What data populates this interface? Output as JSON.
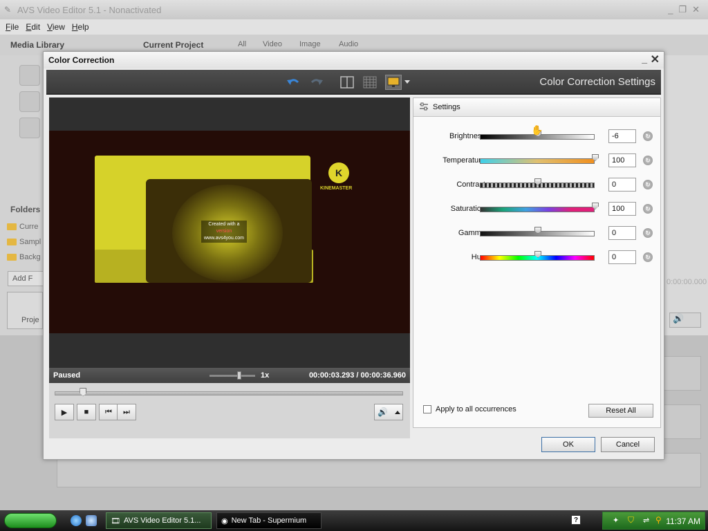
{
  "app": {
    "title": "AVS Video Editor 5.1 - Nonactivated",
    "menu": [
      "File",
      "Edit",
      "View",
      "Help"
    ],
    "media_library_label": "Media Library",
    "current_project_label": "Current Project",
    "filter_tabs": [
      "All",
      "Video",
      "Image",
      "Audio"
    ],
    "folders_label": "Folders",
    "folder_items": [
      "Curre",
      "Sampl",
      "Backg"
    ],
    "add_button_label": "Add F",
    "project_button_label": "Proje",
    "right_time": "0:00:00.000"
  },
  "dialog": {
    "title": "Color Correction",
    "heading": "Color Correction Settings",
    "settings_header": "Settings",
    "status": "Paused",
    "speed": "1x",
    "time": "00:00:03.293 / 00:00:36.960",
    "seek_position": 0.08,
    "speed_position": 0.65,
    "preview_overlay": {
      "brand": "KINEMASTER",
      "logo_letter": "K",
      "line1": "Created with a",
      "line2": "version",
      "line3": "www.avs4you.com"
    },
    "settings": [
      {
        "label": "Brightness:",
        "value": "-6",
        "position": 0.5,
        "track": "linear-gradient(90deg,#000,#fff)"
      },
      {
        "label": "Temperature:",
        "value": "100",
        "position": 1.0,
        "track": "linear-gradient(90deg,#3fd0ea,#e0c070,#f09020)"
      },
      {
        "label": "Contrast:",
        "value": "0",
        "position": 0.5,
        "track": "repeating-linear-gradient(90deg,#222 0 3px,#bbb 3px 6px)"
      },
      {
        "label": "Saturation:",
        "value": "100",
        "position": 1.0,
        "track": "linear-gradient(90deg,#333,#1aa37a,#3fa0e0,#7a3fe0,#e0207a,#e0207a)"
      },
      {
        "label": "Gamma:",
        "value": "0",
        "position": 0.5,
        "track": "linear-gradient(90deg,#111,#fff)"
      },
      {
        "label": "Hue:",
        "value": "0",
        "position": 0.5,
        "track": "linear-gradient(90deg,#ff0000,#ffff00,#00ff00,#00ffff,#0000ff,#ff00ff,#ff0000)"
      }
    ],
    "apply_all_label": "Apply to all occurrences",
    "reset_all_label": "Reset All",
    "ok_label": "OK",
    "cancel_label": "Cancel"
  },
  "taskbar": {
    "tasks": [
      "AVS Video Editor 5.1...",
      "New Tab - Supermium"
    ],
    "clock": "11:37 AM"
  },
  "colors": {
    "toolbar_bg": "#434343",
    "accent_blue": "#3a6ea5"
  },
  "icons": [
    "undo-icon",
    "redo-icon",
    "split-view-icon",
    "grid-view-icon",
    "monitor-icon",
    "settings-sliders-icon",
    "play-icon",
    "stop-icon",
    "prev-frame-icon",
    "next-frame-icon",
    "volume-icon",
    "reset-icon",
    "hand-cursor-icon"
  ]
}
